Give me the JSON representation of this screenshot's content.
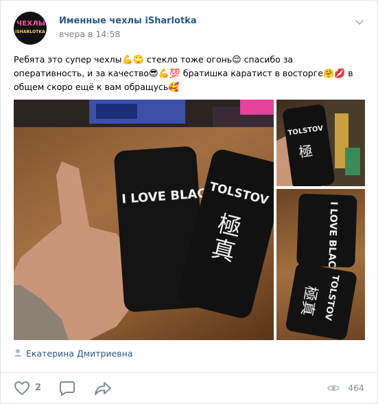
{
  "post": {
    "author": "Именные чехлы iSharlotka",
    "date": "вчера в 14:58",
    "avatar_text_top": "ЧЕХЛЫ",
    "avatar_text_bottom": "iSHARLOTKA",
    "text_part1": "Ребята это супер чехлы",
    "emoji1": "💪🙄",
    "text_part2": " стекло тоже огонь",
    "emoji2": "😌",
    "text_part3": " спасибо за оперативность, и за качество",
    "emoji3": "😎💪💯",
    "text_part4": " братишка каратист в восторге",
    "emoji4": "🤗💋",
    "text_part5": " в общем скоро ещё к вам обращусь",
    "emoji5": "🥰",
    "photos": [
      {
        "name": "photo-main",
        "case1_text": "I LOVE BLACK",
        "case2_text": "TOLSTOV"
      },
      {
        "name": "photo-top-right",
        "case_text": "TOLSTOV"
      },
      {
        "name": "photo-bottom-right",
        "case1_text": "I LOVE BLACK",
        "case2_text": "TOLSTOV"
      }
    ],
    "signer": "Екатерина Дмитриевна",
    "likes": "2",
    "views": "464"
  },
  "colors": {
    "link": "#2a5885",
    "muted": "#828282",
    "icon": "#828a99"
  }
}
